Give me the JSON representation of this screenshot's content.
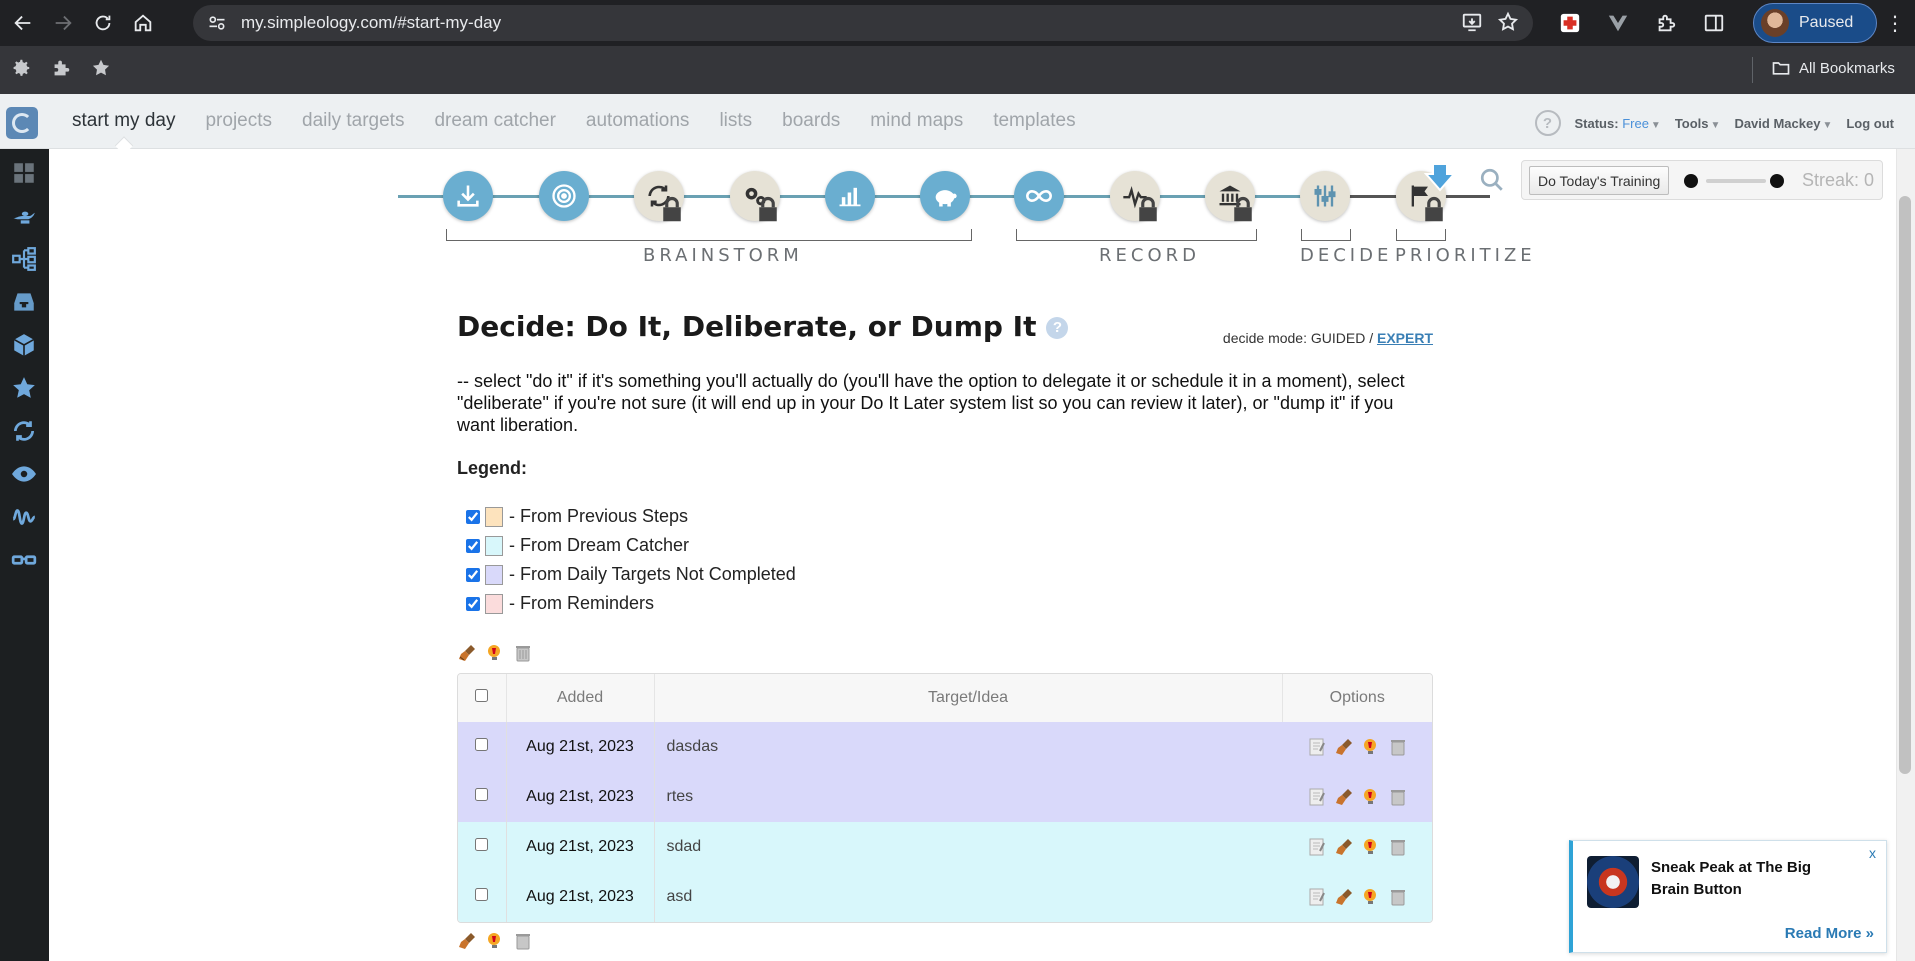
{
  "browser": {
    "url": "my.simpleology.com/#start-my-day",
    "profile_label": "Paused",
    "all_bookmarks": "All Bookmarks"
  },
  "nav": {
    "menu": [
      "start my day",
      "projects",
      "daily targets",
      "dream catcher",
      "automations",
      "lists",
      "boards",
      "mind maps",
      "templates"
    ],
    "status_label": "Status:",
    "status_value": "Free",
    "tools": "Tools",
    "user": "David Mackey",
    "logout": "Log out"
  },
  "workflow": {
    "stages": [
      "BRAINSTORM",
      "RECORD",
      "DECIDE",
      "PRIORITIZE"
    ],
    "training_button": "Do Today's Training",
    "streak": "Streak: 0"
  },
  "page": {
    "title": "Decide: Do It, Deliberate, or Dump It",
    "help": "?",
    "mode_prefix": "decide mode: GUIDED / ",
    "mode_link": "EXPERT",
    "description": "-- select \"do it\" if it's something you'll actually do (you'll have the option to delegate it or schedule it in a moment), select \"deliberate\" if you're not sure (it will end up in your Do It Later system list so you can review it later), or \"dump it\" if you want liberation.",
    "legend_heading": "Legend:",
    "legend": [
      {
        "label": "- From Previous Steps",
        "color": "#fde3bd"
      },
      {
        "label": "- From Dream Catcher",
        "color": "#d8f7fb"
      },
      {
        "label": "- From Daily Targets Not Completed",
        "color": "#d9d9fa"
      },
      {
        "label": "- From Reminders",
        "color": "#fbdcdc"
      }
    ]
  },
  "table": {
    "headers": [
      "Added",
      "Target/Idea",
      "Options"
    ],
    "rows": [
      {
        "date": "Aug 21st, 2023",
        "text": "dasdas"
      },
      {
        "date": "Aug 21st, 2023",
        "text": "rtes"
      },
      {
        "date": "Aug 21st, 2023",
        "text": "sdad"
      },
      {
        "date": "Aug 21st, 2023",
        "text": "asd"
      }
    ]
  },
  "popup": {
    "title": "Sneak Peak at The Big Brain Button",
    "close": "x",
    "read_more": "Read More »"
  }
}
